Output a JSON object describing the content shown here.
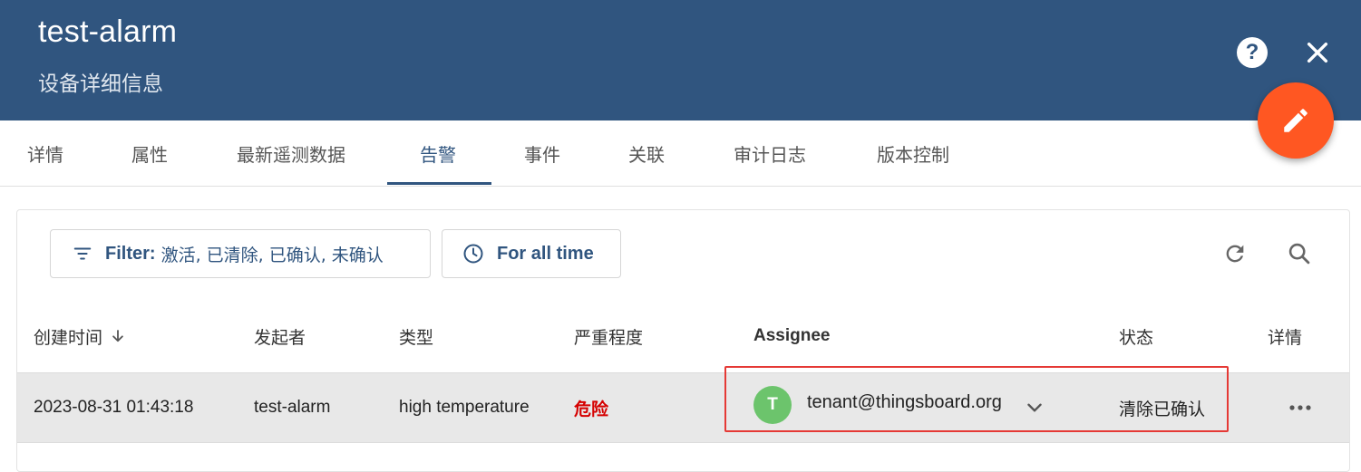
{
  "header": {
    "title": "test-alarm",
    "subtitle": "设备详细信息",
    "help_icon": "help-circle-icon",
    "help_glyph": "?",
    "close_icon": "close-icon",
    "edit_icon": "pencil-icon",
    "edit_color": "#ff5722",
    "bg_color": "#30557f"
  },
  "tabs": [
    {
      "label": "详情"
    },
    {
      "label": "属性"
    },
    {
      "label": "最新遥测数据"
    },
    {
      "label": "告警",
      "active": true
    },
    {
      "label": "事件"
    },
    {
      "label": "关联"
    },
    {
      "label": "审计日志"
    },
    {
      "label": "版本控制"
    }
  ],
  "toolbar": {
    "filter_prefix": "Filter:",
    "filter_value": "激活, 已清除, 已确认, 未确认",
    "time_label": "For all time",
    "filter_icon": "filter-list-icon",
    "time_icon": "clock-icon",
    "refresh_icon": "refresh-icon",
    "search_icon": "search-icon"
  },
  "table": {
    "columns": {
      "created": "创建时间",
      "originator": "发起者",
      "type": "类型",
      "severity": "严重程度",
      "assignee": "Assignee",
      "status": "状态",
      "details": "详情"
    },
    "sort_icon": "arrow-down-icon",
    "rows": [
      {
        "created": "2023-08-31 01:43:18",
        "originator": "test-alarm",
        "type": "high temperature",
        "severity": "危险",
        "severity_color": "#d50000",
        "assignee_initial": "T",
        "assignee_email": "tenant@thingsboard.org",
        "avatar_color": "#6cc46c",
        "status": "清除已确认",
        "more_icon": "more-horiz-icon"
      }
    ]
  }
}
